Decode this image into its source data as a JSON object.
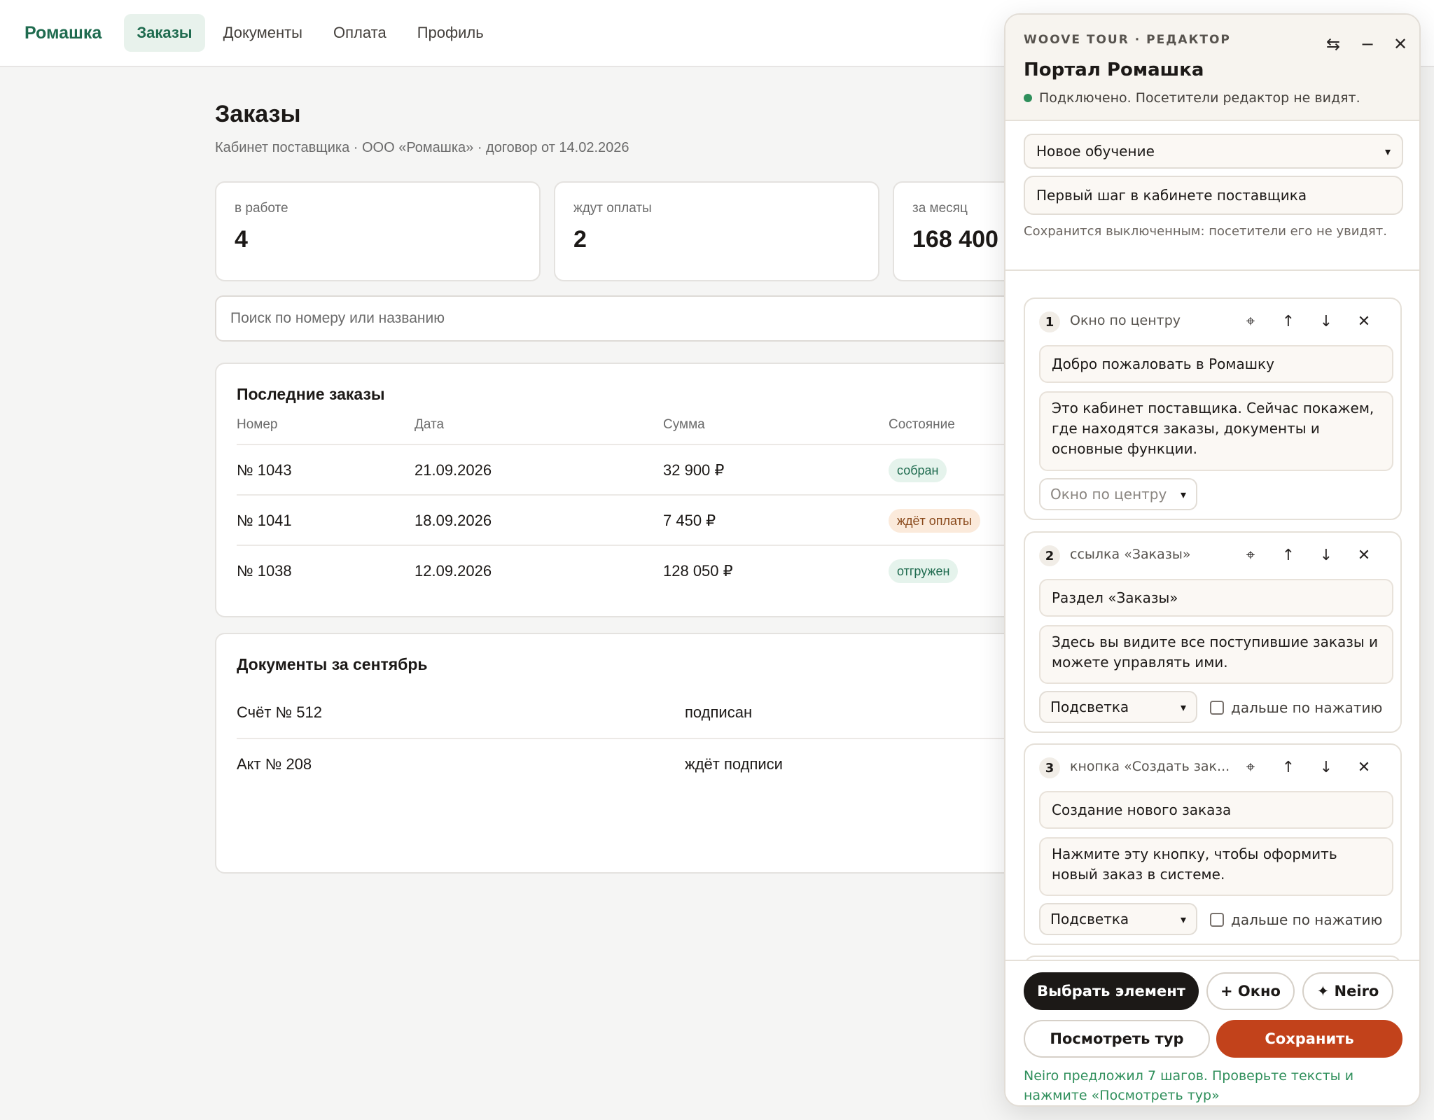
{
  "app": {
    "brand": "Ромашка"
  },
  "nav": [
    {
      "label": "Заказы",
      "active": true
    },
    {
      "label": "Документы",
      "active": false
    },
    {
      "label": "Оплата",
      "active": false
    },
    {
      "label": "Профиль",
      "active": false
    }
  ],
  "page": {
    "title": "Заказы",
    "subtitle": "Кабинет поставщика · ООО «Ромашка» · договор от 14.02.2026"
  },
  "stats": [
    {
      "label": "в работе",
      "value": "4"
    },
    {
      "label": "ждут оплаты",
      "value": "2"
    },
    {
      "label": "за месяц",
      "value": "168 400"
    }
  ],
  "search": {
    "placeholder": "Поиск по номеру или названию"
  },
  "orders": {
    "title": "Последние заказы",
    "columns": [
      "Номер",
      "Дата",
      "Сумма",
      "Состояние"
    ],
    "rows": [
      {
        "number": "№ 1043",
        "date": "21.09.2026",
        "sum": "32 900 ₽",
        "status": "собран",
        "status_color": "#e5f3ec"
      },
      {
        "number": "№ 1041",
        "date": "18.09.2026",
        "sum": "7 450 ₽",
        "status": "ждёт оплаты",
        "status_color": "#fbeadb"
      },
      {
        "number": "№ 1038",
        "date": "12.09.2026",
        "sum": "128 050 ₽",
        "status": "отгружен",
        "status_color": "#e5f3ec"
      }
    ]
  },
  "documents": {
    "title": "Документы за сентябрь",
    "rows": [
      {
        "name": "Счёт № 512",
        "state": "подписан"
      },
      {
        "name": "Акт № 208",
        "state": "ждёт подписи"
      }
    ]
  },
  "editor": {
    "kicker": "WOOVE TOUR · РЕДАКТОР",
    "title": "Портал Ромашка",
    "status": "Подключено. Посетители редактор не видят.",
    "status_color": "#2f8f5b",
    "tour_select": "Новое обучение",
    "tour_name": "Первый шаг в кабинете поставщика",
    "save_note": "Сохранится выключенным: посетители его не увидят.",
    "steps": [
      {
        "num": "1",
        "target": "Окно по центру",
        "title": "Добро пожаловать в Ромашку",
        "body": "Это кабинет поставщика. Сейчас покажем, где находятся заказы, документы и основные функции.",
        "mode": "Окно по центру",
        "checkbox": ""
      },
      {
        "num": "2",
        "target": "ссылка «Заказы»",
        "title": "Раздел «Заказы»",
        "body": "Здесь вы видите все поступившие заказы и можете управлять ими.",
        "mode": "Подсветка",
        "checkbox": "дальше по нажатию"
      },
      {
        "num": "3",
        "target": "кнопка «Создать зак...",
        "title": "Создание нового заказа",
        "body": "Нажмите эту кнопку, чтобы оформить новый заказ в системе.",
        "mode": "Подсветка",
        "checkbox": "дальше по нажатию"
      }
    ],
    "buttons": {
      "pick": "Выбрать элемент",
      "window": "+ Окно",
      "neiro": "✦ Neiro",
      "preview": "Посмотреть тур",
      "save": "Сохранить"
    },
    "footer_message": "Neiro предложил 7 шагов. Проверьте тексты и нажмите «Посмотреть тур»",
    "accent_color": "#c2421b"
  }
}
